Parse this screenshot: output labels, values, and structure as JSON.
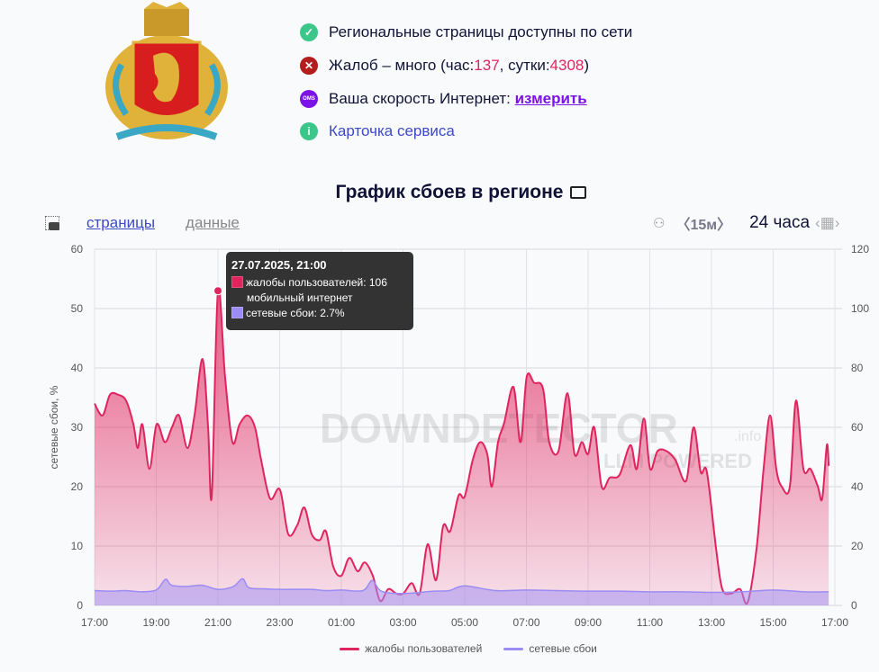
{
  "status": {
    "line1": "Региональные страницы доступны по сети",
    "line2_prefix": "Жалоб – много (час: ",
    "hour_count": "137",
    "line2_mid": ", сутки: ",
    "day_count": "4308",
    "line2_suffix": ")",
    "line3_prefix": "Ваша скорость Интернет: ",
    "measure_link": "измерить",
    "speed_icon_text": "OMS",
    "card_link": "Карточка сервиса"
  },
  "title": "График сбоев в регионе",
  "tabs": {
    "pages": "страницы",
    "data": "данные"
  },
  "controls": {
    "interval": "〈15м〉",
    "period": "24 часа"
  },
  "watermark": {
    "brand": "DOWNDETECTOR",
    "suffix": ".info",
    "sub": "LLM POWERED"
  },
  "tooltip": {
    "date": "27.07.2025, 21:00",
    "complaints": "жалобы пользователей: 106",
    "complaints_sub": "мобильный интернет",
    "failures": "сетевые сбои: 2.7%"
  },
  "colors": {
    "complaints": "#e0245e",
    "failures": "#9b8cf5",
    "green": "#3cc68a",
    "red": "#b51d1d",
    "purple": "#7b13e8"
  },
  "chart_data": {
    "type": "area",
    "ylabel": "сетевые сбои, %",
    "ylim": [
      0,
      60
    ],
    "yticks": [
      0,
      10,
      20,
      30,
      40,
      50,
      60
    ],
    "y2lim": [
      0,
      120
    ],
    "y2ticks": [
      0,
      20,
      40,
      60,
      80,
      100,
      120
    ],
    "xlim_hours": [
      0,
      24
    ],
    "xticks": [
      "17:00",
      "19:00",
      "21:00",
      "23:00",
      "01:00",
      "03:00",
      "05:00",
      "07:00",
      "09:00",
      "11:00",
      "13:00",
      "15:00",
      "17:00"
    ],
    "legend": [
      "жалобы пользователей",
      "сетевые сбои"
    ],
    "series": [
      {
        "name": "жалобы пользователей",
        "axis": "right",
        "x": [
          0,
          0.26,
          0.5,
          0.76,
          1.02,
          1.26,
          1.4,
          1.55,
          1.78,
          2.01,
          2.28,
          2.51,
          2.74,
          3.01,
          3.24,
          3.5,
          3.68,
          3.8,
          4,
          4.23,
          4.47,
          4.7,
          4.96,
          5.2,
          5.4,
          5.69,
          6.01,
          6.28,
          6.57,
          6.8,
          7.04,
          7.3,
          7.5,
          7.74,
          8,
          8.26,
          8.53,
          8.76,
          9.02,
          9.26,
          9.52,
          9.78,
          10.01,
          10.28,
          10.54,
          10.8,
          11.07,
          11.3,
          11.53,
          11.8,
          12,
          12.26,
          12.5,
          12.73,
          12.88,
          13.08,
          13.28,
          13.58,
          13.81,
          14.01,
          14.25,
          14.54,
          14.74,
          15.04,
          15.33,
          15.56,
          15.8,
          16,
          16.2,
          16.44,
          16.7,
          17.02,
          17.37,
          17.58,
          17.81,
          18.01,
          18.25,
          18.54,
          18.83,
          19.18,
          19.42,
          19.65,
          19.85,
          20.15,
          20.35,
          20.64,
          20.93,
          21.17,
          21.46,
          21.69,
          21.9,
          22.1,
          22.28,
          22.54,
          22.74,
          22.98,
          23.21,
          23.45,
          23.59,
          23.74,
          23.8
        ],
        "values": [
          68,
          64,
          71,
          71,
          69,
          61,
          53,
          61,
          46,
          61,
          55,
          60,
          64,
          53,
          64,
          83,
          60,
          37,
          106,
          77,
          55,
          61,
          64,
          60,
          49,
          36,
          39,
          24,
          27,
          33,
          24,
          22,
          25,
          13,
          10,
          16,
          11.5,
          14.5,
          10,
          1.5,
          5.5,
          4,
          4,
          7.5,
          4,
          20.6,
          8.5,
          26.7,
          25,
          37,
          36.7,
          49,
          55,
          51,
          40,
          55,
          61.5,
          73.6,
          55,
          77,
          75,
          73,
          55,
          52,
          71.5,
          51,
          55,
          51,
          60,
          40,
          43,
          44,
          54,
          46,
          63,
          46,
          52,
          52,
          49,
          42,
          60,
          45,
          45,
          19,
          5.5,
          4,
          5.5,
          1,
          19,
          46,
          64,
          46,
          40,
          40,
          69,
          46,
          46,
          40,
          36,
          54,
          47
        ]
      },
      {
        "name": "сетевые сбои",
        "axis": "left",
        "x": [
          0,
          0.5,
          1,
          1.5,
          2,
          2.3,
          2.5,
          3,
          3.5,
          4,
          4.5,
          4.8,
          5,
          5.5,
          6,
          7,
          7.5,
          8,
          8.7,
          9,
          9.3,
          10,
          11,
          11.5,
          12,
          13,
          14,
          15,
          16,
          17,
          18,
          19,
          20,
          21,
          22,
          23,
          23.8
        ],
        "values": [
          2.5,
          2.4,
          2.5,
          2.3,
          2.6,
          4.4,
          3.4,
          3.2,
          3.4,
          2.7,
          3.2,
          4.5,
          3.0,
          2.8,
          2.7,
          2.7,
          2.5,
          2.6,
          2.5,
          4.2,
          2.4,
          2.0,
          2.4,
          2.5,
          3.3,
          2.5,
          2.6,
          2.5,
          2.4,
          2.4,
          2.3,
          2.3,
          2.2,
          2.3,
          2.6,
          2.3,
          2.3
        ]
      }
    ]
  }
}
